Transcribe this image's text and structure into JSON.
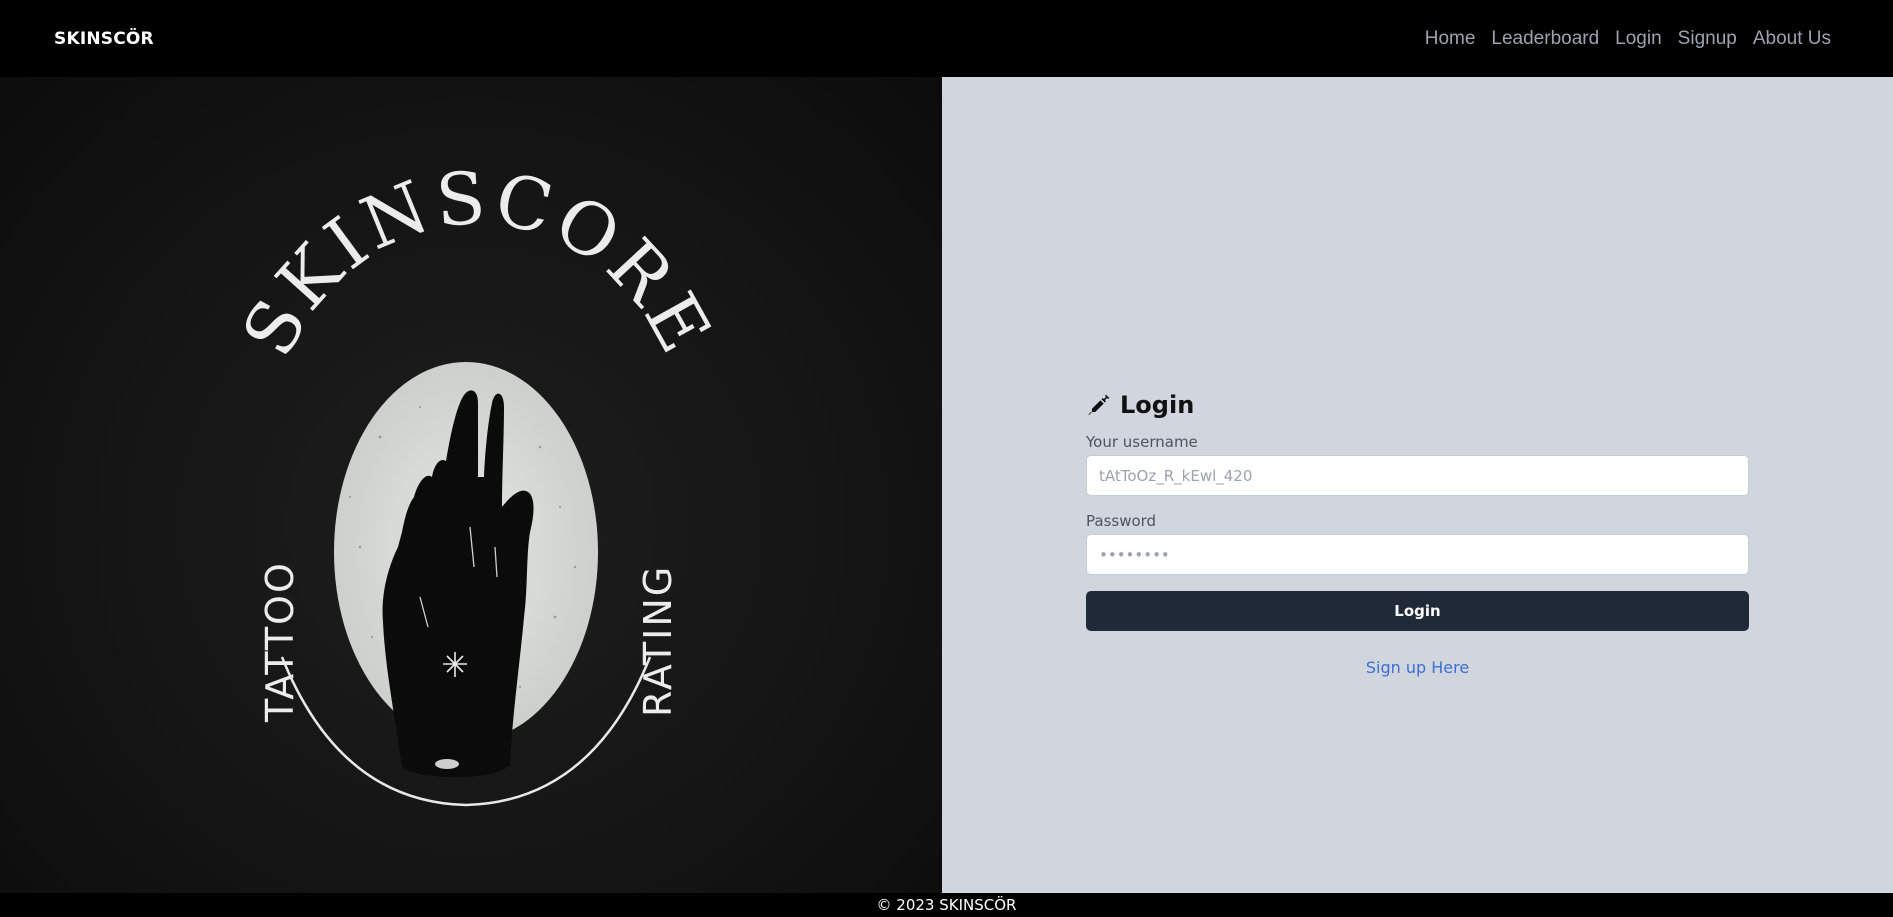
{
  "navbar": {
    "brand": "SKINSCÖR",
    "links": [
      {
        "label": "Home"
      },
      {
        "label": "Leaderboard"
      },
      {
        "label": "Login"
      },
      {
        "label": "Signup"
      },
      {
        "label": "About Us"
      }
    ]
  },
  "hero_logo": {
    "arc_text": "SKINSCORE",
    "left_text": "TATTOO",
    "right_text": "RATING",
    "icon": "hand-icon"
  },
  "login": {
    "title": "Login",
    "title_icon": "syringe-icon",
    "username_label": "Your username",
    "username_placeholder": "tAtToOz_R_kEwl_420",
    "password_label": "Password",
    "password_placeholder": "••••••••",
    "submit_label": "Login",
    "signup_link": "Sign up Here"
  },
  "footer": {
    "text": "© 2023 SKINSCÖR"
  },
  "colors": {
    "navbar_bg": "#000000",
    "panel_bg": "#d1d5de",
    "button_bg": "#1f2937",
    "link": "#3b6fd4"
  }
}
